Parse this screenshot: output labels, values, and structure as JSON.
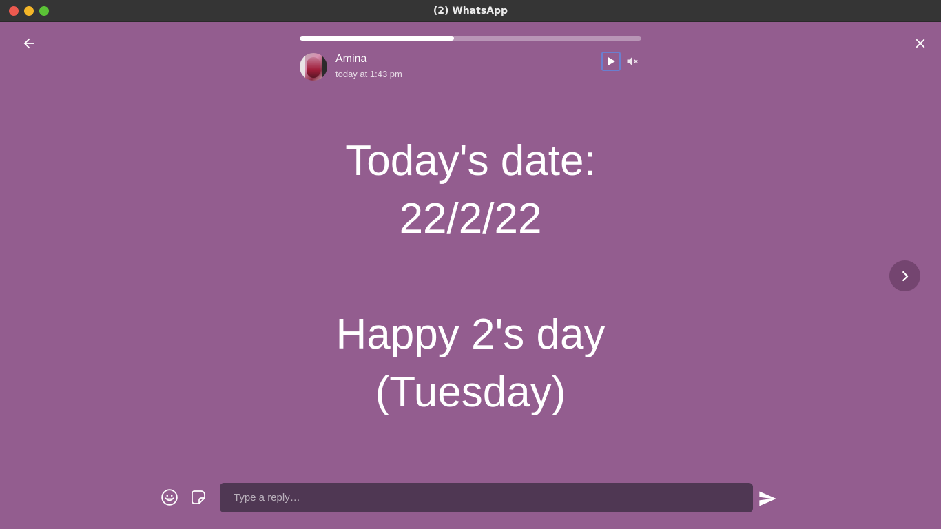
{
  "window": {
    "title": "(2) WhatsApp"
  },
  "status": {
    "progress_fraction": 0.452,
    "contact_name": "Amina",
    "time": "today at 1:43 pm",
    "lines": [
      "Today's date:",
      "22/2/22",
      "",
      "Happy 2's day",
      "(Tuesday)"
    ],
    "background_color": "#935d8f"
  },
  "reply": {
    "placeholder": "Type a reply…"
  },
  "icons": {
    "back": "arrow-left-icon",
    "close": "close-icon",
    "play": "play-icon",
    "mute": "volume-muted-icon",
    "next": "chevron-right-icon",
    "emoji": "emoji-icon",
    "sticker": "sticker-icon",
    "send": "send-icon"
  }
}
